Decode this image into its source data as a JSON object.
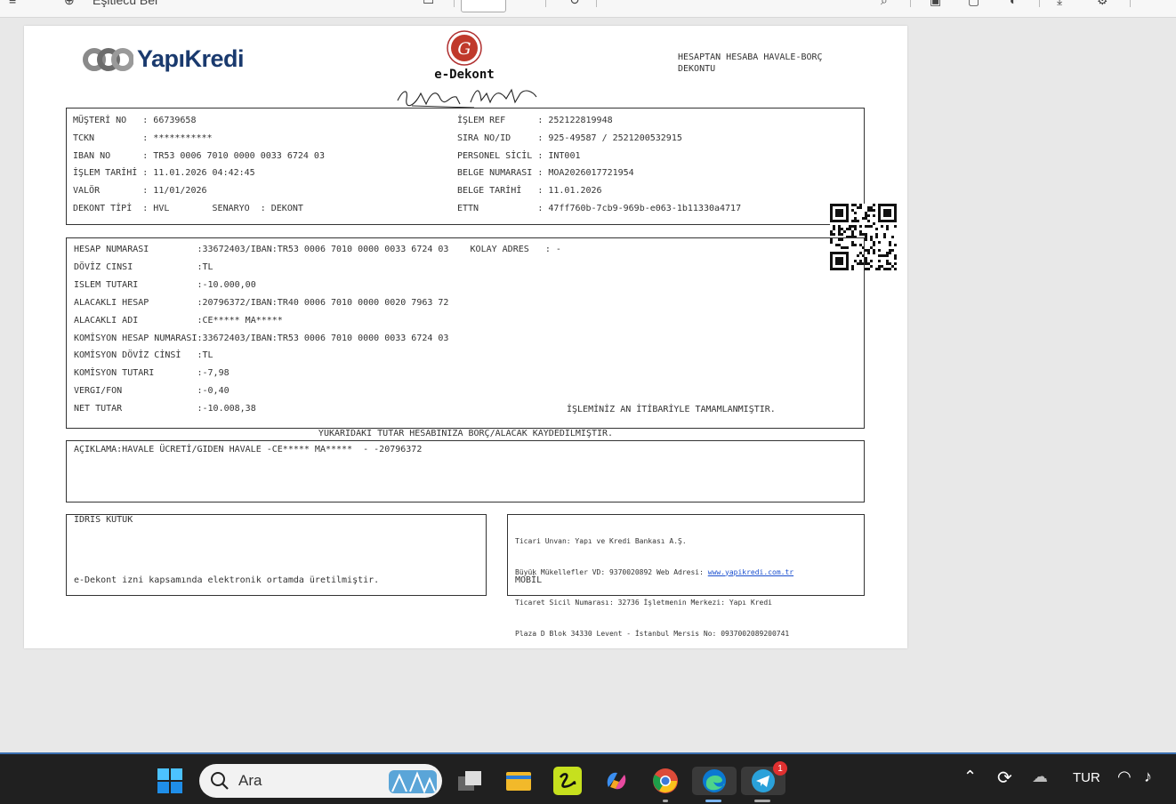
{
  "viewer": {
    "file_name": "Eşitlecü Bel"
  },
  "header": {
    "bank_name": "YapıKredi",
    "edekont_title": "e-Dekont",
    "doc_type": "HESAPTAN HESABA HAVALE-BORÇ\nDEKONTU"
  },
  "info_left": [
    {
      "label": "MÜŞTERİ NO  ",
      "value": "66739658"
    },
    {
      "label": "TCKN        ",
      "value": "***********"
    },
    {
      "label": "IBAN NO     ",
      "value": "TR53 0006 7010 0000 0033 6724 03"
    },
    {
      "label": "İŞLEM TARİHİ",
      "value": "11.01.2026 04:42:45"
    },
    {
      "label": "VALÖR       ",
      "value": "11/01/2026"
    },
    {
      "label": "DEKONT TİPİ ",
      "value": "HVL        SENARYO  : DEKONT"
    }
  ],
  "info_right": [
    {
      "label": "İŞLEM REF     ",
      "value": "252122819948"
    },
    {
      "label": "SIRA NO/ID    ",
      "value": "925-49587 / 2521200532915"
    },
    {
      "label": "PERSONEL SİCİL",
      "value": "INT001"
    },
    {
      "label": "BELGE NUMARASI",
      "value": "MOA2026017721954"
    },
    {
      "label": "BELGE TARİHİ  ",
      "value": "11.01.2026"
    },
    {
      "label": "ETTN          ",
      "value": "47ff760b-7cb9-969b-e063-1b11330a4717"
    }
  ],
  "details": [
    {
      "label": "HESAP NUMARASI         ",
      "value": ":33672403/IBAN:TR53 0006 7010 0000 0033 6724 03    KOLAY ADRES   : -"
    },
    {
      "label": "DÖVİZ CINSI            ",
      "value": ":TL"
    },
    {
      "label": "ISLEM TUTARI           ",
      "value": ":-10.000,00"
    },
    {
      "label": "ALACAKLI HESAP         ",
      "value": ":20796372/IBAN:TR40 0006 7010 0000 0020 7963 72"
    },
    {
      "label": "ALACAKLI ADI           ",
      "value": ":CE***** MA*****"
    },
    {
      "label": "KOMİSYON HESAP NUMARASI",
      "value": ":33672403/IBAN:TR53 0006 7010 0000 0033 6724 03"
    },
    {
      "label": "KOMİSYON DÖVİZ CİNSİ   ",
      "value": ":TL"
    },
    {
      "label": "KOMİSYON TUTARI        ",
      "value": ":-7,98"
    },
    {
      "label": "VERGI/FON              ",
      "value": ":-0,40"
    },
    {
      "label": "NET TUTAR              ",
      "value": ":-10.008,38"
    }
  ],
  "completion_note": "İŞLEMİNİZ AN İTİBARİYLE TAMAMLANMIŞTIR.",
  "mid_note": "YUKARIDAKİ TUTAR HESABINIZA BORÇ/ALACAK KAYDEDİLMİŞTİR.",
  "description": "AÇIKLAMA:HAVALE ÜCRETİ/GIDEN HAVALE -CE***** MA*****  - -20796372",
  "footer_left": {
    "name": "İDRİS KÜTÜK",
    "note": "e-Dekont izni kapsamında elektronik ortamda üretilmiştir."
  },
  "footer_right": {
    "line1": "Ticari Unvan: Yapı ve Kredi Bankası A.Ş.",
    "line2_prefix": "Büyük Mükellefler VD: 9370020892 Web Adresi: ",
    "website": "www.yapikredi.com.tr",
    "line3": "Ticaret Sicil Numarası: 32736 İşletmenin Merkezi: Yapı Kredi",
    "line4": "Plaza D Blok 34330 Levent - İstanbul Mersis No: 0937002089200741",
    "channel": "MOBİL"
  },
  "taskbar": {
    "search_placeholder": "Ara",
    "telegram_badge": "1",
    "language": "TUR"
  }
}
